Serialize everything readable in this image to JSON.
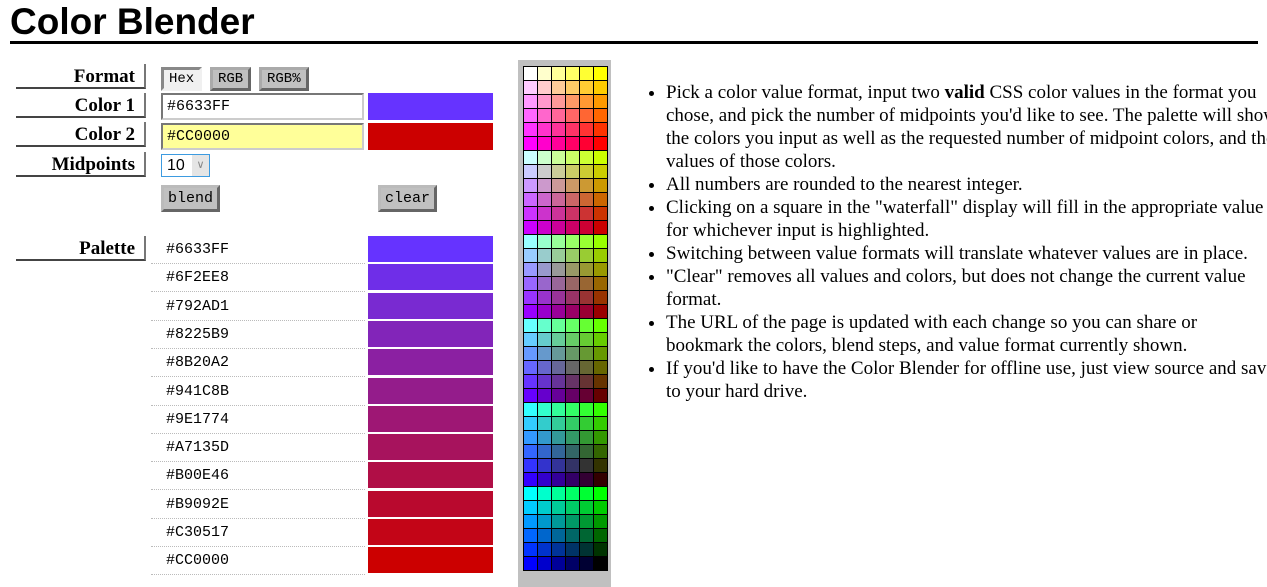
{
  "title": "Color Blender",
  "labels": {
    "format": "Format",
    "color1": "Color 1",
    "color2": "Color 2",
    "midpoints": "Midpoints",
    "palette": "Palette"
  },
  "format_buttons": [
    {
      "label": "Hex",
      "active": true
    },
    {
      "label": "RGB",
      "active": false
    },
    {
      "label": "RGB%",
      "active": false
    }
  ],
  "color1": {
    "value": "#6633FF",
    "swatch": "#6633FF",
    "highlighted": false
  },
  "color2": {
    "value": "#CC0000",
    "swatch": "#CC0000",
    "highlighted": true,
    "highlight_color": "#FFFF99"
  },
  "midpoints": {
    "value": "10"
  },
  "buttons": {
    "blend": "blend",
    "clear": "clear"
  },
  "palette": [
    "#6633FF",
    "#6F2EE8",
    "#792AD1",
    "#8225B9",
    "#8B20A2",
    "#941C8B",
    "#9E1774",
    "#A7135D",
    "#B00E46",
    "#B9092E",
    "#C30517",
    "#CC0000"
  ],
  "waterfall": {
    "levels": [
      "FF",
      "CC",
      "99",
      "66",
      "33",
      "00"
    ],
    "description": "216 web-safe colors; 6 blocks (red level), rows (green level), columns (blue level)"
  },
  "help": [
    {
      "pre": "Pick a color value format, input two ",
      "bold": "valid",
      "post": " CSS color values in the format you chose, and pick the number of midpoints you'd like to see. The palette will show the colors you input as well as the requested number of midpoint colors, and the values of those colors."
    },
    {
      "pre": "All numbers are rounded to the nearest integer.",
      "bold": "",
      "post": ""
    },
    {
      "pre": "Clicking on a square in the \"waterfall\" display will fill in the appropriate value for whichever input is highlighted.",
      "bold": "",
      "post": ""
    },
    {
      "pre": "Switching between value formats will translate whatever values are in place.",
      "bold": "",
      "post": ""
    },
    {
      "pre": "\"Clear\" removes all values and colors, but does not change the current value format.",
      "bold": "",
      "post": ""
    },
    {
      "pre": "The URL of the page is updated with each change so you can share or bookmark the colors, blend steps, and value format currently shown.",
      "bold": "",
      "post": ""
    },
    {
      "pre": "If you'd like to have the Color Blender for offline use, just view source and save to your hard drive.",
      "bold": "",
      "post": ""
    }
  ]
}
